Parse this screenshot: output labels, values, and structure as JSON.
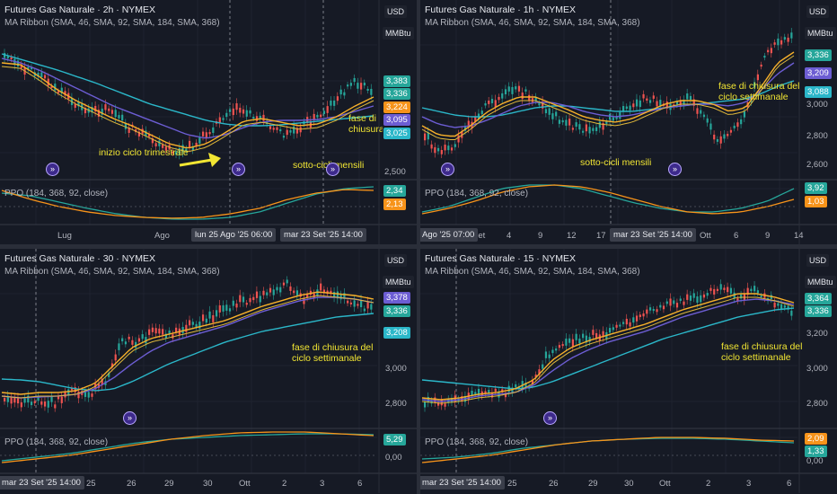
{
  "colors": {
    "bg": "#161a25",
    "green": "#26a69a",
    "red": "#ef5350",
    "sma46": "#f7b02a",
    "sma92": "#6c5dd3",
    "sma184": "#2bb7c9",
    "ppo_line": "#26a69a",
    "ppo_signal": "#f7931a",
    "annotation": "#f2e633"
  },
  "panels": [
    {
      "title": "Futures Gas Naturale · 2h · NYMEX",
      "subtitle": "MA Ribbon (SMA, 46, SMA, 92, SMA, 184, SMA, 368)",
      "currency": "USD",
      "unit": "MMBtu",
      "price_tags": [
        {
          "v": "3,383",
          "c": "#26a69a"
        },
        {
          "v": "3,336",
          "c": "#26a69a"
        },
        {
          "v": "3,224",
          "c": "#f7931a"
        },
        {
          "v": "3,095",
          "c": "#6c5dd3"
        },
        {
          "v": "3,025",
          "c": "#2bb7c9"
        }
      ],
      "price_scale": [
        "2,500"
      ],
      "ppo_label": "PPO (184, 368, 92, close)",
      "ppo_tags": [
        {
          "v": "2,34",
          "c": "#26a69a"
        },
        {
          "v": "2,13",
          "c": "#f7931a"
        }
      ],
      "x_labels": [
        "Lug",
        "Ago"
      ],
      "x_badges": [
        "lun 25 Ago '25   06:00",
        "mar 23 Set '25   14:00"
      ],
      "annotations": [
        "inizio ciclo trimestrale",
        "sotto-cicli mensili",
        "fase di chiusura del ciclo"
      ]
    },
    {
      "title": "Futures Gas Naturale · 1h · NYMEX",
      "subtitle": "MA Ribbon (SMA, 46, SMA, 92, SMA, 184, SMA, 368)",
      "currency": "USD",
      "unit": "MMBtu",
      "price_tags": [
        {
          "v": "3,336",
          "c": "#26a69a"
        },
        {
          "v": "3,209",
          "c": "#6c5dd3"
        },
        {
          "v": "3,088",
          "c": "#2bb7c9"
        }
      ],
      "price_scale": [
        "3,000",
        "2,800",
        "2,600"
      ],
      "ppo_label": "PPO (184, 368, 92, close)",
      "ppo_tags": [
        {
          "v": "3,92",
          "c": "#26a69a"
        },
        {
          "v": "1,03",
          "c": "#f7931a"
        }
      ],
      "x_labels": [
        "Set",
        "4",
        "9",
        "12",
        "17",
        "Ott",
        "6",
        "9",
        "14"
      ],
      "x_badges": [
        "Ago '25   07:00",
        "mar 23 Set '25   14:00"
      ],
      "annotations": [
        "sotto-cicli mensili",
        "fase di chiusura del ciclo settimanale"
      ]
    },
    {
      "title": "Futures Gas Naturale · 30 · NYMEX",
      "subtitle": "MA Ribbon (SMA, 46, SMA, 92, SMA, 184, SMA, 368)",
      "currency": "USD",
      "unit": "MMBtu",
      "price_tags": [
        {
          "v": "3,378",
          "c": "#6c5dd3"
        },
        {
          "v": "3,336",
          "c": "#26a69a"
        },
        {
          "v": "3,208",
          "c": "#2bb7c9"
        }
      ],
      "price_scale": [
        "3,000",
        "2,800"
      ],
      "ppo_label": "PPO (184, 368, 92, close)",
      "ppo_tags": [
        {
          "v": "5,29",
          "c": "#26a69a"
        }
      ],
      "ppo_scale": [
        "0,00"
      ],
      "x_labels": [
        "25",
        "26",
        "29",
        "30",
        "Ott",
        "2",
        "3",
        "6"
      ],
      "x_badges": [
        "mar 23 Set '25   14:00"
      ],
      "annotations": [
        "fase di chiusura del ciclo settimanale"
      ]
    },
    {
      "title": "Futures Gas Naturale · 15 · NYMEX",
      "subtitle": "MA Ribbon (SMA, 46, SMA, 92, SMA, 184, SMA, 368)",
      "currency": "USD",
      "unit": "MMBtu",
      "price_tags": [
        {
          "v": "3,364",
          "c": "#26a69a"
        },
        {
          "v": "3,336",
          "c": "#26a69a"
        }
      ],
      "price_scale": [
        "3,200",
        "3,000",
        "2,800"
      ],
      "ppo_label": "PPO (184, 368, 92, close)",
      "ppo_tags": [
        {
          "v": "2,09",
          "c": "#f7931a"
        },
        {
          "v": "1,33",
          "c": "#26a69a"
        }
      ],
      "ppo_scale": [
        "0,00"
      ],
      "x_labels": [
        "25",
        "26",
        "29",
        "30",
        "Ott",
        "2",
        "3",
        "6"
      ],
      "x_badges": [
        "mar 23 Set '25   14:00"
      ],
      "annotations": [
        "fase di chiusura del ciclo settimanale"
      ]
    }
  ]
}
